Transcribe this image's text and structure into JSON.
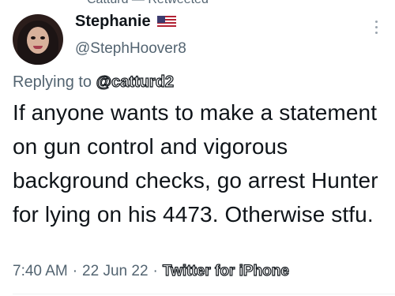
{
  "top_context": "Catturd — Retweeted",
  "author": {
    "name": "Stephanie",
    "handle": "@StephHoover8",
    "flag_icon": "us-flag-icon"
  },
  "reply": {
    "prefix": "Replying to",
    "mention": "@catturd2"
  },
  "tweet": {
    "text": "If anyone wants to make a statement on gun control and vigorous background checks, go arrest Hunter for lying on his 4473. Otherwise stfu."
  },
  "meta": {
    "time": "7:40 AM",
    "sep1": "·",
    "date": "22 Jun 22",
    "sep2": "·",
    "client": "Twitter for iPhone"
  },
  "colors": {
    "text": "#0f1419",
    "secondary": "#536471",
    "divider": "#eff3f4"
  }
}
